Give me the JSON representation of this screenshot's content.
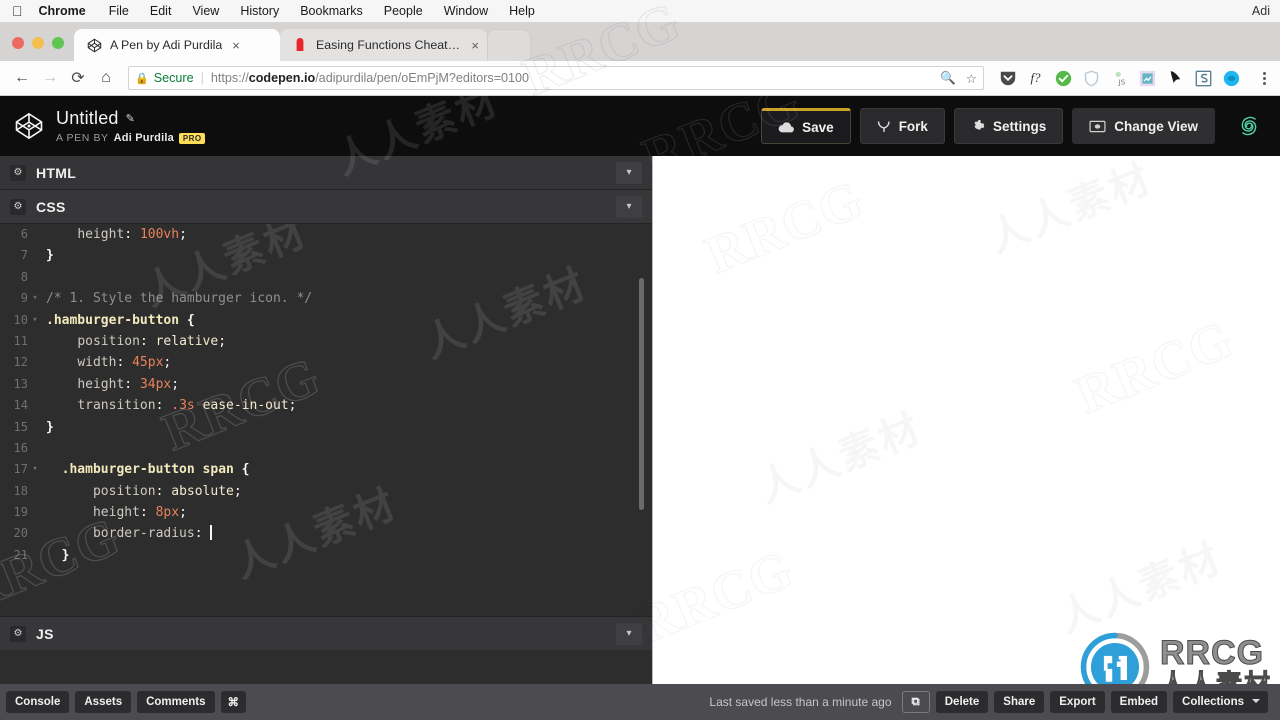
{
  "os_menu": {
    "apple_icon": "apple-icon",
    "items": [
      "Chrome",
      "File",
      "Edit",
      "View",
      "History",
      "Bookmarks",
      "People",
      "Window",
      "Help"
    ],
    "user": "Adi"
  },
  "browser": {
    "tabs": [
      {
        "title": "A Pen by Adi Purdila",
        "favicon": "codepen-icon",
        "active": true,
        "close": "×"
      },
      {
        "title": "Easing Functions Cheat Sheet",
        "favicon": "red-pin-icon",
        "active": false,
        "close": "×"
      }
    ],
    "new_tab_label": "",
    "nav": {
      "back": "←",
      "forward": "→",
      "reload": "⟳",
      "home": "⌂"
    },
    "omnibox": {
      "lock_icon": "lock-icon",
      "secure_label": "Secure",
      "url_scheme": "https://",
      "url_domain": "codepen.io",
      "url_path": "/adipurdila/pen/oEmPjM?editors=0100",
      "zoom_icon": "zoom-out-icon",
      "star_icon": "star-icon"
    },
    "extensions": [
      "pocket-icon",
      "font-inspector-icon",
      "check-circle-icon",
      "shield-icon",
      "js-toggle-icon",
      "image-icon",
      "pen-tool-icon",
      "s-icon",
      "blue-circle-icon"
    ],
    "menu_icon": "kebab-menu-icon"
  },
  "codepen": {
    "logo_icon": "codepen-logo-icon",
    "pen_title": "Untitled",
    "edit_title_icon": "pencil-icon",
    "byline_prefix": "A PEN BY",
    "author": "Adi Purdila",
    "pro_badge": "PRO",
    "buttons": [
      {
        "label": "Save",
        "icon": "cloud-icon",
        "style": "save"
      },
      {
        "label": "Fork",
        "icon": "fork-icon",
        "style": "outline"
      },
      {
        "label": "Settings",
        "icon": "gear-icon",
        "style": "outline"
      },
      {
        "label": "Change View",
        "icon": "view-icon",
        "style": "flat"
      }
    ],
    "spiral_icon": "spiral-icon",
    "spiral_color": "#4fd1a5"
  },
  "panes": {
    "html": {
      "label": "HTML",
      "gear_icon": "gear-icon",
      "chevron": "⌄"
    },
    "css": {
      "label": "CSS",
      "gear_icon": "gear-icon",
      "chevron": "⌄"
    },
    "js": {
      "label": "JS",
      "gear_icon": "gear-icon",
      "chevron": "⌄"
    }
  },
  "editor": {
    "first_line_number": 6,
    "lines": [
      {
        "n": 6,
        "fold": "",
        "tokens": [
          {
            "t": "    ",
            "c": "t-plain"
          },
          {
            "t": "height",
            "c": "t-prop"
          },
          {
            "t": ": ",
            "c": "t-punc"
          },
          {
            "t": "100vh",
            "c": "t-num"
          },
          {
            "t": ";",
            "c": "t-punc"
          }
        ]
      },
      {
        "n": 7,
        "fold": "",
        "tokens": [
          {
            "t": "}",
            "c": "t-brace"
          }
        ]
      },
      {
        "n": 8,
        "fold": "",
        "tokens": []
      },
      {
        "n": 9,
        "fold": "▾",
        "tokens": [
          {
            "t": "/* 1. Style the hamburger icon. */",
            "c": "t-comment"
          }
        ]
      },
      {
        "n": 10,
        "fold": "▾",
        "tokens": [
          {
            "t": ".hamburger-button",
            "c": "t-sel"
          },
          {
            "t": " {",
            "c": "t-brace"
          }
        ]
      },
      {
        "n": 11,
        "fold": "",
        "tokens": [
          {
            "t": "    ",
            "c": "t-plain"
          },
          {
            "t": "position",
            "c": "t-prop"
          },
          {
            "t": ": ",
            "c": "t-punc"
          },
          {
            "t": "relative",
            "c": "t-val"
          },
          {
            "t": ";",
            "c": "t-punc"
          }
        ]
      },
      {
        "n": 12,
        "fold": "",
        "tokens": [
          {
            "t": "    ",
            "c": "t-plain"
          },
          {
            "t": "width",
            "c": "t-prop"
          },
          {
            "t": ": ",
            "c": "t-punc"
          },
          {
            "t": "45px",
            "c": "t-num"
          },
          {
            "t": ";",
            "c": "t-punc"
          }
        ]
      },
      {
        "n": 13,
        "fold": "",
        "tokens": [
          {
            "t": "    ",
            "c": "t-plain"
          },
          {
            "t": "height",
            "c": "t-prop"
          },
          {
            "t": ": ",
            "c": "t-punc"
          },
          {
            "t": "34px",
            "c": "t-num"
          },
          {
            "t": ";",
            "c": "t-punc"
          }
        ]
      },
      {
        "n": 14,
        "fold": "",
        "tokens": [
          {
            "t": "    ",
            "c": "t-plain"
          },
          {
            "t": "transition",
            "c": "t-prop"
          },
          {
            "t": ": ",
            "c": "t-punc"
          },
          {
            "t": ".3s",
            "c": "t-num"
          },
          {
            "t": " ",
            "c": "t-plain"
          },
          {
            "t": "ease-in-out",
            "c": "t-val"
          },
          {
            "t": ";",
            "c": "t-punc"
          }
        ]
      },
      {
        "n": 15,
        "fold": "",
        "tokens": [
          {
            "t": "}",
            "c": "t-brace"
          }
        ]
      },
      {
        "n": 16,
        "fold": "",
        "tokens": []
      },
      {
        "n": 17,
        "fold": "▾",
        "tokens": [
          {
            "t": "  ",
            "c": "t-plain"
          },
          {
            "t": ".hamburger-button span",
            "c": "t-sel"
          },
          {
            "t": " {",
            "c": "t-brace"
          }
        ]
      },
      {
        "n": 18,
        "fold": "",
        "tokens": [
          {
            "t": "      ",
            "c": "t-plain"
          },
          {
            "t": "position",
            "c": "t-prop"
          },
          {
            "t": ": ",
            "c": "t-punc"
          },
          {
            "t": "absolute",
            "c": "t-val"
          },
          {
            "t": ";",
            "c": "t-punc"
          }
        ]
      },
      {
        "n": 19,
        "fold": "",
        "tokens": [
          {
            "t": "      ",
            "c": "t-plain"
          },
          {
            "t": "height",
            "c": "t-prop"
          },
          {
            "t": ": ",
            "c": "t-punc"
          },
          {
            "t": "8px",
            "c": "t-num"
          },
          {
            "t": ";",
            "c": "t-punc"
          }
        ]
      },
      {
        "n": 20,
        "fold": "",
        "tokens": [
          {
            "t": "      ",
            "c": "t-plain"
          },
          {
            "t": "border-radius",
            "c": "t-prop"
          },
          {
            "t": ": ",
            "c": "t-punc"
          },
          {
            "t": "",
            "c": "caret-here"
          }
        ]
      },
      {
        "n": 21,
        "fold": "",
        "tokens": [
          {
            "t": "  ",
            "c": "t-plain"
          },
          {
            "t": "}",
            "c": "t-brace"
          }
        ]
      }
    ],
    "caret_line": 20,
    "scrollbar": "vertical-scrollbar"
  },
  "footer": {
    "left_buttons": [
      "Console",
      "Assets",
      "Comments",
      "⌘"
    ],
    "saved_status": "Last saved less than a minute ago",
    "right_buttons": [
      {
        "label": "⧉",
        "name": "open-external-button",
        "ghost": true
      },
      {
        "label": "Delete",
        "name": "delete-button"
      },
      {
        "label": "Share",
        "name": "share-button"
      },
      {
        "label": "Export",
        "name": "export-button"
      },
      {
        "label": "Embed",
        "name": "embed-button"
      },
      {
        "label": "Collections",
        "name": "collections-button",
        "caret": true
      }
    ]
  },
  "watermarks": {
    "text_latin": "RRCG",
    "text_cn": "人人素材",
    "logo_latin": "RRCG",
    "logo_cn": "人人素材"
  }
}
